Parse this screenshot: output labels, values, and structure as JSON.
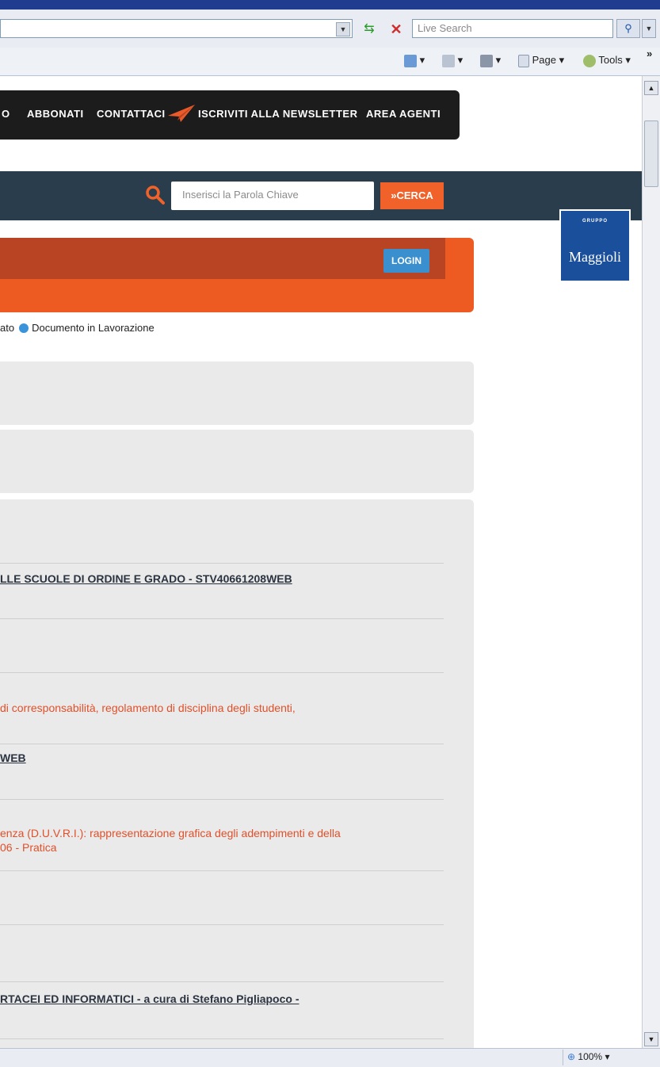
{
  "browser": {
    "search_placeholder": "Live Search",
    "commands": {
      "page": "Page",
      "tools": "Tools",
      "more": "»"
    },
    "zoom": "100%"
  },
  "nav": {
    "items": [
      "O",
      "ABBONATI",
      "CONTATTACI",
      "ISCRIVITI ALLA NEWSLETTER",
      "AREA AGENTI"
    ]
  },
  "logo": {
    "group": "GRUPPO",
    "name": "Maggioli"
  },
  "search": {
    "placeholder": "Inserisci la Parola Chiave",
    "button": "»CERCA"
  },
  "login_label": "LOGIN",
  "legend": {
    "prefix": "ato",
    "in_progress": "Documento in Lavorazione"
  },
  "documents": [
    {
      "text": "LLE SCUOLE DI ORDINE E GRADO - STV40661208WEB",
      "style": "link"
    },
    {
      "text": "di corresponsabilità, regolamento di disciplina degli studenti,",
      "style": "red"
    },
    {
      "text": "WEB",
      "style": "link"
    },
    {
      "text": "enza (D.U.V.R.I.): rappresentazione grafica degli adempimenti e della",
      "text2": "06 - Pratica",
      "style": "red"
    },
    {
      "text": "RTACEI ED INFORMATICI - a cura di Stefano Pigliapoco -",
      "style": "link"
    }
  ],
  "colors": {
    "nav_bg": "#1c1c1c",
    "search_band": "#2a3d4d",
    "accent_orange": "#ed5a22",
    "login_blue": "#3a8fcf",
    "status_dot": "#3b93d9",
    "doc_red": "#e0502a"
  }
}
